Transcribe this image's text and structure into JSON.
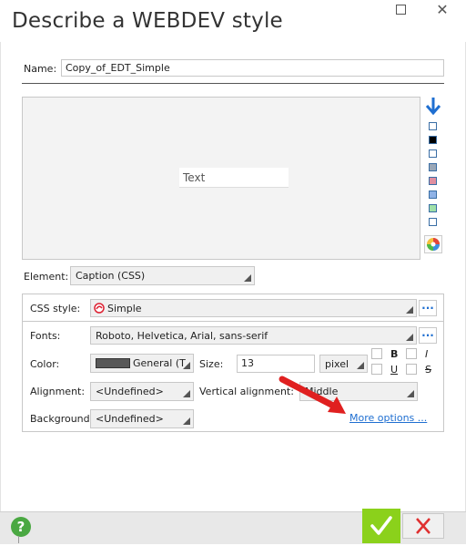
{
  "window": {
    "title": "Describe a WEBDEV style"
  },
  "name": {
    "label": "Name:",
    "value": "Copy_of_EDT_Simple"
  },
  "preview": {
    "text": "Text"
  },
  "swatches": [
    "#ffffff",
    "#000000",
    "#ffffff",
    "#9aa7b7",
    "#e08fa0",
    "#8fb2e6",
    "#9fe0a8",
    "#ffffff"
  ],
  "element": {
    "label": "Element:",
    "value": "Caption (CSS)"
  },
  "css_style": {
    "label": "CSS style:",
    "value": "Simple",
    "more": "..."
  },
  "fonts": {
    "label": "Fonts:",
    "value": "Roboto, Helvetica, Arial, sans-serif",
    "more": "..."
  },
  "color": {
    "label": "Color:",
    "value": "General (T"
  },
  "size": {
    "label": "Size:",
    "value": "13",
    "unit": "pixel"
  },
  "style_flags": {
    "bold": "B",
    "italic": "I",
    "underline": "U",
    "strike": "S"
  },
  "alignment": {
    "label": "Alignment:",
    "value": "<Undefined>"
  },
  "vertical_alignment": {
    "label": "Vertical alignment:",
    "value": "Middle"
  },
  "background": {
    "label": "Background:",
    "value": "<Undefined>"
  },
  "more_options": "More options ...",
  "buttons": {
    "help": "?"
  }
}
